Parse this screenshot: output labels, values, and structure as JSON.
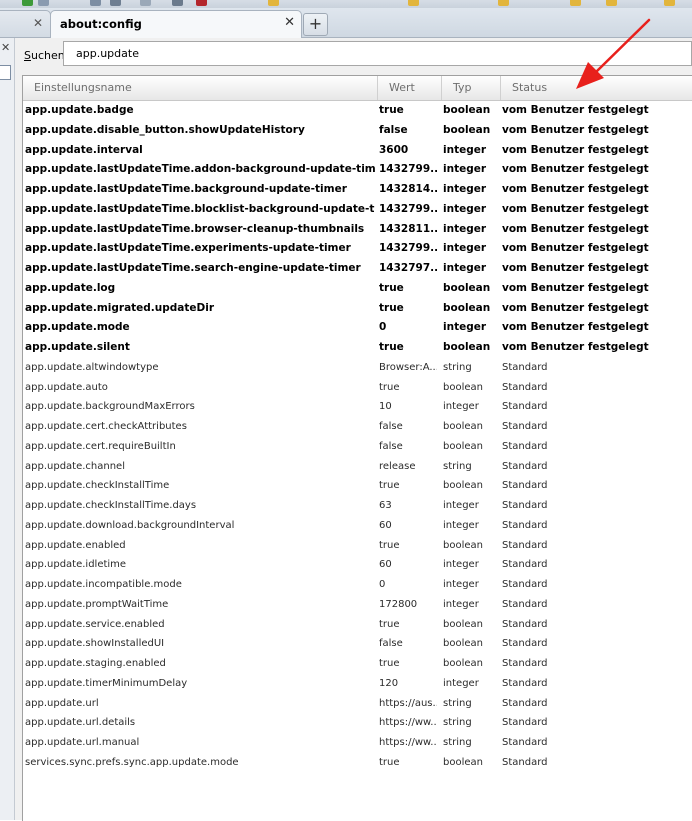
{
  "tabs": [
    {
      "label": ""
    },
    {
      "label": "about:config"
    }
  ],
  "search": {
    "label_accel": "S",
    "label_rest": "uchen:",
    "value": "app.update"
  },
  "columns": {
    "name": "Einstellungsname",
    "value": "Wert",
    "type": "Typ",
    "status": "Status"
  },
  "rows": [
    {
      "name": "app.update.badge",
      "value": "true",
      "type": "boolean",
      "status": "vom Benutzer festgelegt",
      "modified": true
    },
    {
      "name": "app.update.disable_button.showUpdateHistory",
      "value": "false",
      "type": "boolean",
      "status": "vom Benutzer festgelegt",
      "modified": true
    },
    {
      "name": "app.update.interval",
      "value": "3600",
      "type": "integer",
      "status": "vom Benutzer festgelegt",
      "modified": true
    },
    {
      "name": "app.update.lastUpdateTime.addon-background-update-timer",
      "value": "1432799...",
      "type": "integer",
      "status": "vom Benutzer festgelegt",
      "modified": true
    },
    {
      "name": "app.update.lastUpdateTime.background-update-timer",
      "value": "1432814...",
      "type": "integer",
      "status": "vom Benutzer festgelegt",
      "modified": true
    },
    {
      "name": "app.update.lastUpdateTime.blocklist-background-update-timer",
      "value": "1432799...",
      "type": "integer",
      "status": "vom Benutzer festgelegt",
      "modified": true
    },
    {
      "name": "app.update.lastUpdateTime.browser-cleanup-thumbnails",
      "value": "1432811...",
      "type": "integer",
      "status": "vom Benutzer festgelegt",
      "modified": true
    },
    {
      "name": "app.update.lastUpdateTime.experiments-update-timer",
      "value": "1432799...",
      "type": "integer",
      "status": "vom Benutzer festgelegt",
      "modified": true
    },
    {
      "name": "app.update.lastUpdateTime.search-engine-update-timer",
      "value": "1432797...",
      "type": "integer",
      "status": "vom Benutzer festgelegt",
      "modified": true
    },
    {
      "name": "app.update.log",
      "value": "true",
      "type": "boolean",
      "status": "vom Benutzer festgelegt",
      "modified": true
    },
    {
      "name": "app.update.migrated.updateDir",
      "value": "true",
      "type": "boolean",
      "status": "vom Benutzer festgelegt",
      "modified": true
    },
    {
      "name": "app.update.mode",
      "value": "0",
      "type": "integer",
      "status": "vom Benutzer festgelegt",
      "modified": true
    },
    {
      "name": "app.update.silent",
      "value": "true",
      "type": "boolean",
      "status": "vom Benutzer festgelegt",
      "modified": true
    },
    {
      "name": "app.update.altwindowtype",
      "value": "Browser:A...",
      "type": "string",
      "status": "Standard",
      "modified": false
    },
    {
      "name": "app.update.auto",
      "value": "true",
      "type": "boolean",
      "status": "Standard",
      "modified": false
    },
    {
      "name": "app.update.backgroundMaxErrors",
      "value": "10",
      "type": "integer",
      "status": "Standard",
      "modified": false
    },
    {
      "name": "app.update.cert.checkAttributes",
      "value": "false",
      "type": "boolean",
      "status": "Standard",
      "modified": false
    },
    {
      "name": "app.update.cert.requireBuiltIn",
      "value": "false",
      "type": "boolean",
      "status": "Standard",
      "modified": false
    },
    {
      "name": "app.update.channel",
      "value": "release",
      "type": "string",
      "status": "Standard",
      "modified": false
    },
    {
      "name": "app.update.checkInstallTime",
      "value": "true",
      "type": "boolean",
      "status": "Standard",
      "modified": false
    },
    {
      "name": "app.update.checkInstallTime.days",
      "value": "63",
      "type": "integer",
      "status": "Standard",
      "modified": false
    },
    {
      "name": "app.update.download.backgroundInterval",
      "value": "60",
      "type": "integer",
      "status": "Standard",
      "modified": false
    },
    {
      "name": "app.update.enabled",
      "value": "true",
      "type": "boolean",
      "status": "Standard",
      "modified": false
    },
    {
      "name": "app.update.idletime",
      "value": "60",
      "type": "integer",
      "status": "Standard",
      "modified": false
    },
    {
      "name": "app.update.incompatible.mode",
      "value": "0",
      "type": "integer",
      "status": "Standard",
      "modified": false
    },
    {
      "name": "app.update.promptWaitTime",
      "value": "172800",
      "type": "integer",
      "status": "Standard",
      "modified": false
    },
    {
      "name": "app.update.service.enabled",
      "value": "true",
      "type": "boolean",
      "status": "Standard",
      "modified": false
    },
    {
      "name": "app.update.showInstalledUI",
      "value": "false",
      "type": "boolean",
      "status": "Standard",
      "modified": false
    },
    {
      "name": "app.update.staging.enabled",
      "value": "true",
      "type": "boolean",
      "status": "Standard",
      "modified": false
    },
    {
      "name": "app.update.timerMinimumDelay",
      "value": "120",
      "type": "integer",
      "status": "Standard",
      "modified": false
    },
    {
      "name": "app.update.url",
      "value": "https://aus...",
      "type": "string",
      "status": "Standard",
      "modified": false
    },
    {
      "name": "app.update.url.details",
      "value": "https://ww...",
      "type": "string",
      "status": "Standard",
      "modified": false
    },
    {
      "name": "app.update.url.manual",
      "value": "https://ww...",
      "type": "string",
      "status": "Standard",
      "modified": false
    },
    {
      "name": "services.sync.prefs.sync.app.update.mode",
      "value": "true",
      "type": "boolean",
      "status": "Standard",
      "modified": false
    }
  ],
  "colors": {
    "annotation_arrow": "#e8201c",
    "tabbar_bg": "#d6dee7",
    "header_text": "#6e6e6e"
  },
  "icons": [
    "close-icon",
    "plus-icon",
    "arrow-annotation"
  ]
}
